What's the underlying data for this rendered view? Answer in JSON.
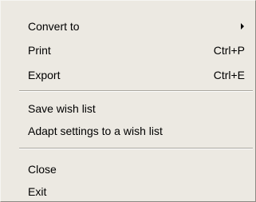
{
  "menu": {
    "items": [
      {
        "label": "Convert to",
        "shortcut": "",
        "submenu": true
      },
      {
        "label": "Print",
        "shortcut": "Ctrl+P"
      },
      {
        "label": "Export",
        "shortcut": "Ctrl+E"
      },
      {
        "label": "Save wish list",
        "shortcut": ""
      },
      {
        "label": "Adapt settings to a wish list",
        "shortcut": ""
      },
      {
        "label": "Close",
        "shortcut": ""
      },
      {
        "label": "Exit",
        "shortcut": ""
      }
    ]
  }
}
